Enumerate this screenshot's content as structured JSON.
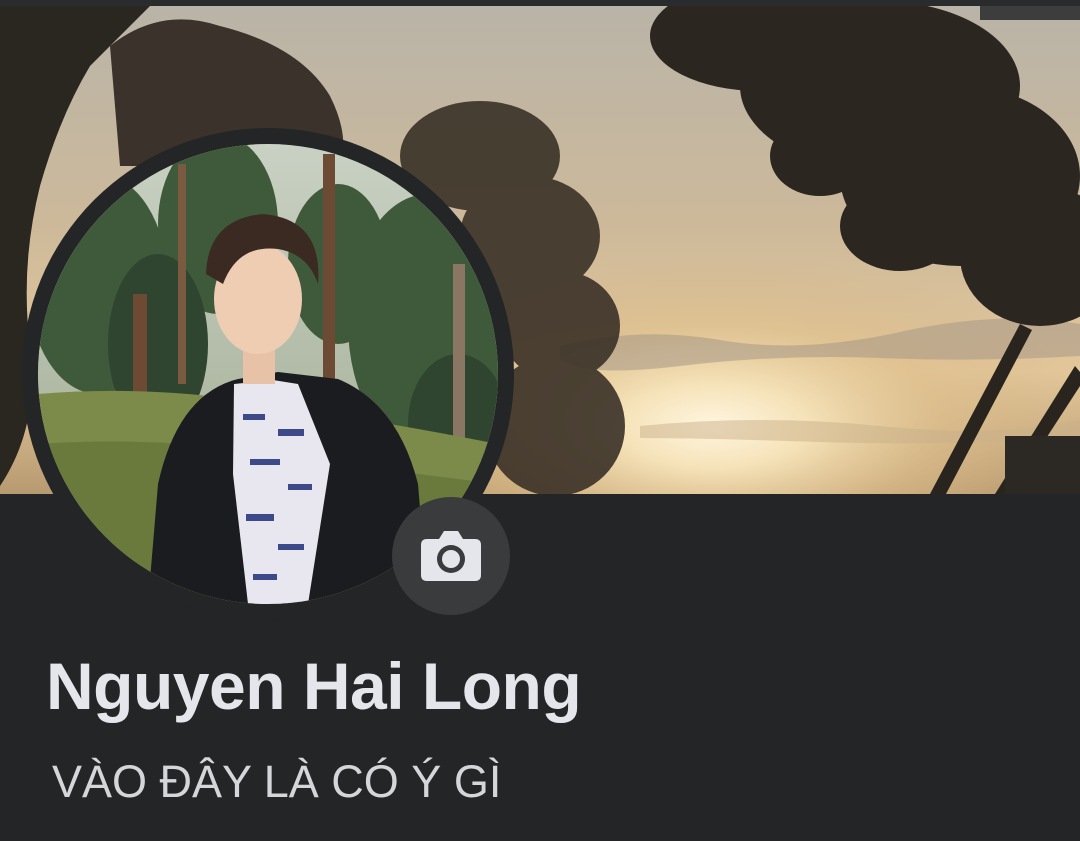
{
  "profile": {
    "name": "Nguyen Hai Long",
    "bio": "VÀO ĐÂY LÀ CÓ Ý GÌ"
  },
  "cover": {
    "image": "sunset-trees-cover-photo"
  },
  "avatar": {
    "image": "profile-photo-person-in-park"
  },
  "actions": {
    "update_photo_icon": "camera-icon"
  },
  "colors": {
    "background": "#242526",
    "name_text": "#e4e6eb",
    "bio_text": "#d4d6da",
    "camera_button": "#3a3b3c"
  }
}
